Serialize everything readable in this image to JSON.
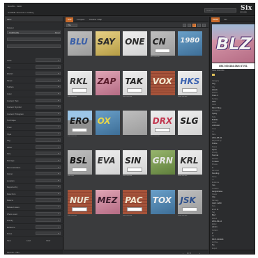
{
  "app": {
    "title": "Graffiti - Web",
    "breadcrumb": "GraffDB / Records / Catalog",
    "search_placeholder": "Search",
    "brand": "Six",
    "brand_sub": "SIXSENSE"
  },
  "sidebar": {
    "header": "Filter",
    "dataset_label": "Dataset",
    "dataset_value": "Graffiti (All)",
    "reset_label": "Reset",
    "filters": [
      {
        "label": "Case"
      },
      {
        "label": "City"
      },
      {
        "label": "District"
      },
      {
        "label": "Street"
      },
      {
        "label": "Surface"
      },
      {
        "label": "Color"
      },
      {
        "label": "Content: Text"
      },
      {
        "label": "Content: Symbol"
      },
      {
        "label": "Content: Pictogram"
      },
      {
        "label": "Technique"
      },
      {
        "label": "Crew"
      },
      {
        "label": "Style"
      },
      {
        "label": "Tag"
      },
      {
        "label": "Writer"
      },
      {
        "label": "Size"
      },
      {
        "label": "Damage"
      },
      {
        "label": "Removal status"
      },
      {
        "label": "Owner"
      },
      {
        "label": "Location"
      },
      {
        "label": "Reported by"
      },
      {
        "label": "Date from"
      },
      {
        "label": "Date to"
      },
      {
        "label": "Related cases"
      },
      {
        "label": "Photo count"
      },
      {
        "label": "Priority"
      },
      {
        "label": "Evidence"
      },
      {
        "label": "Notes"
      }
    ],
    "actions": [
      "Save",
      "Load",
      "Clear"
    ],
    "footer": "Records: 2 584"
  },
  "main": {
    "tabs": [
      "Grid",
      "Compare",
      "Timeline / Map"
    ],
    "active_tab": 0,
    "view_mode": "Tile",
    "pager": {
      "page_label": "1 / 9",
      "prev": "‹",
      "next": "›"
    },
    "thumbs": [
      {
        "style": "w-gray",
        "tag": "BLU",
        "tag_color": "#3a5fa8",
        "caption": ""
      },
      {
        "style": "w-yellow",
        "tag": "SAY",
        "tag_color": "#2b2b2b",
        "caption": ""
      },
      {
        "style": "w-white",
        "tag": "ONE",
        "tag_color": "#2c2c2c",
        "caption": ""
      },
      {
        "style": "w-gray",
        "tag": "CN",
        "tag_color": "#1e1e1e",
        "caption": "8547-002184"
      },
      {
        "style": "w-blue",
        "tag": "1980",
        "tag_color": "#f2f2f2",
        "caption": ""
      },
      {
        "style": "w-white",
        "tag": "RKL",
        "tag_color": "#333",
        "caption": "8547-002184"
      },
      {
        "style": "w-pink",
        "tag": "ZAP",
        "tag_color": "#5a1c2c",
        "caption": ""
      },
      {
        "style": "w-white",
        "tag": "TAK",
        "tag_color": "#222",
        "caption": "8547-002184"
      },
      {
        "style": "w-brick",
        "tag": "VOX",
        "tag_color": "#f1e9d0",
        "caption": ""
      },
      {
        "style": "w-white",
        "tag": "HKS",
        "tag_color": "#3b62b0",
        "caption": "8547-002184"
      },
      {
        "style": "w-sky",
        "tag": "ERO",
        "tag_color": "#1b1b1b",
        "caption": "8547-002184"
      },
      {
        "style": "w-blue",
        "tag": "OX",
        "tag_color": "#e8d64a",
        "caption": ""
      },
      {
        "style": "w-gray",
        "tag": "",
        "tag_color": "#222",
        "caption": ""
      },
      {
        "style": "w-white",
        "tag": "DRX",
        "tag_color": "#c2374f",
        "caption": "8547-002184"
      },
      {
        "style": "w-white",
        "tag": "SLG",
        "tag_color": "#1e1e1e",
        "caption": ""
      },
      {
        "style": "w-gray",
        "tag": "BSL",
        "tag_color": "#111",
        "caption": "0547-001"
      },
      {
        "style": "w-white",
        "tag": "EVA",
        "tag_color": "#333",
        "caption": ""
      },
      {
        "style": "w-white",
        "tag": "SIN",
        "tag_color": "#222",
        "caption": "8547-002184"
      },
      {
        "style": "w-green",
        "tag": "GRN",
        "tag_color": "#e8e8e8",
        "caption": ""
      },
      {
        "style": "w-white",
        "tag": "KRL",
        "tag_color": "#2d2d2d",
        "caption": "8547-002184"
      },
      {
        "style": "w-brick",
        "tag": "NUF",
        "tag_color": "#e9e4d2",
        "caption": "8547-002184"
      },
      {
        "style": "w-pink",
        "tag": "MEZ",
        "tag_color": "#3a1a2b",
        "caption": ""
      },
      {
        "style": "w-brick",
        "tag": "PAC",
        "tag_color": "#f0e6cf",
        "caption": "8547-002184"
      },
      {
        "style": "w-blue",
        "tag": "TOX",
        "tag_color": "#f0f0f0",
        "caption": ""
      },
      {
        "style": "w-gray",
        "tag": "JSK",
        "tag_color": "#2d4f8c",
        "caption": "8547-002184"
      }
    ]
  },
  "detail": {
    "tabs": [
      "Details",
      "Info"
    ],
    "active_tab": 0,
    "preview_tag": "BLZ",
    "caption": "8547-004184-08/4 UT/S1",
    "subline": "Case 2011/084",
    "swatch_color": "#e1c25a",
    "rows": [
      {
        "k": "Category",
        "v": "Tag"
      },
      {
        "k": "City",
        "v": "Zürich"
      },
      {
        "k": "District",
        "v": "Kreis 4"
      },
      {
        "k": "Surface",
        "v": "Wall"
      },
      {
        "k": "Color",
        "v": "Pink / Blue"
      },
      {
        "k": "Technique",
        "v": "Spray"
      },
      {
        "k": "Style",
        "v": "Bubble"
      },
      {
        "k": "Writer",
        "v": "unknown"
      },
      {
        "k": "Crew",
        "v": "—"
      },
      {
        "k": "Date",
        "v": "2011-08-04"
      },
      {
        "k": "Reported by",
        "v": "Police"
      },
      {
        "k": "Status",
        "v": "Open"
      },
      {
        "k": "Priority",
        "v": "Normal"
      },
      {
        "k": "Related",
        "v": "3 cases"
      },
      {
        "k": "Photos",
        "v": "4"
      },
      {
        "k": "Removal",
        "v": "Pending"
      },
      {
        "k": "Notes",
        "v": "—"
      },
      {
        "k": "Evidence",
        "v": "Yes"
      },
      {
        "k": "Location",
        "v": "Langstrasse"
      },
      {
        "k": "Owner",
        "v": "City"
      },
      {
        "k": "Damage",
        "v": "CHF 1 200"
      },
      {
        "k": "Size",
        "v": "2 x 1 m"
      },
      {
        "k": "Tag",
        "v": "BLZ"
      },
      {
        "k": "Edited",
        "v": "2011-09-12"
      },
      {
        "k": "Editor",
        "v": "admin"
      },
      {
        "k": "Version",
        "v": "2"
      },
      {
        "k": "ID",
        "v": "8547-004184"
      },
      {
        "k": "Archive",
        "v": "No"
      },
      {
        "k": "Export",
        "v": "PDF"
      }
    ]
  }
}
